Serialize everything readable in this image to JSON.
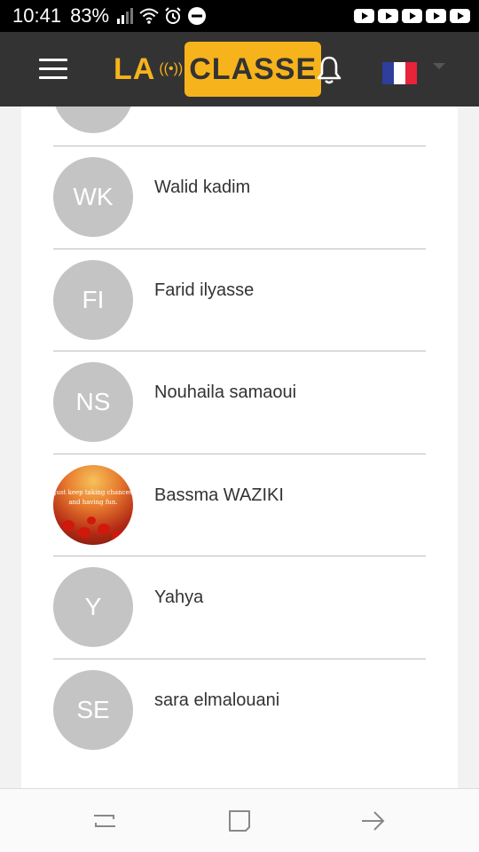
{
  "status_bar": {
    "time": "10:41",
    "battery": "83%",
    "icons": [
      "signal-icon",
      "wifi-icon",
      "alarm-icon",
      "do-not-disturb-icon"
    ],
    "notifications": [
      "youtube-icon",
      "youtube-icon",
      "youtube-icon",
      "youtube-icon",
      "youtube-icon"
    ]
  },
  "header": {
    "logo_left": "LA",
    "logo_right": "CLASSE",
    "brand_color": "#f6b31b",
    "background": "#333333",
    "language_flag": "france-flag-icon"
  },
  "members": [
    {
      "initials": "",
      "name": ""
    },
    {
      "initials": "WK",
      "name": "Walid kadim"
    },
    {
      "initials": "FI",
      "name": "Farid ilyasse"
    },
    {
      "initials": "NS",
      "name": "Nouhaila samaoui"
    },
    {
      "initials": "",
      "name": "Bassma WAZIKI",
      "photo_text": "Just keep taking chances and having fun."
    },
    {
      "initials": "Y",
      "name": "Yahya"
    },
    {
      "initials": "SE",
      "name": "sara elmalouani"
    }
  ],
  "avatar_color": "#c4c4c4",
  "nav_bar": {
    "buttons": [
      "recent-apps-icon",
      "home-icon",
      "back-icon"
    ]
  }
}
